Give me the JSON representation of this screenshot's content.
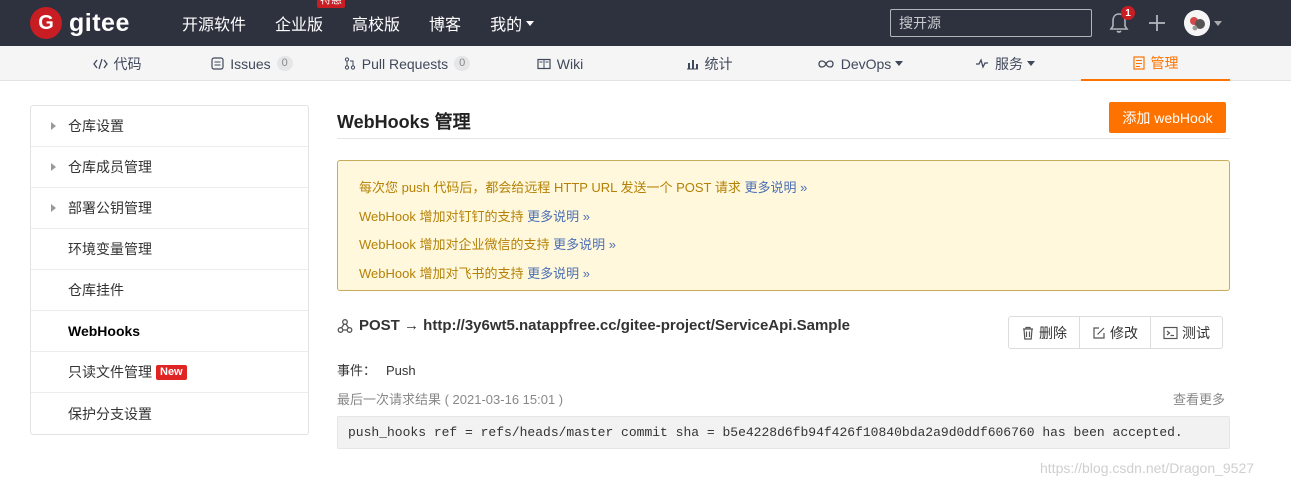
{
  "brand": {
    "badge": "G",
    "name": "gitee",
    "color": "#c71d23"
  },
  "topnav": {
    "links": [
      "开源软件",
      "企业版",
      "高校版",
      "博客",
      "我的"
    ],
    "hot_badge": "特惠",
    "search_placeholder": "搜开源",
    "notification_count": "1"
  },
  "repo_tabs": [
    {
      "label": "代码",
      "icon": "code-icon"
    },
    {
      "label": "Issues",
      "icon": "issues-icon",
      "count": "0"
    },
    {
      "label": "Pull Requests",
      "icon": "pull-request-icon",
      "count": "0"
    },
    {
      "label": "Wiki",
      "icon": "book-icon"
    },
    {
      "label": "统计",
      "icon": "bar-chart-icon"
    },
    {
      "label": "DevOps",
      "icon": "infinity-icon"
    },
    {
      "label": "服务",
      "icon": "pulse-icon"
    },
    {
      "label": "管理",
      "icon": "manage-icon",
      "active": true
    }
  ],
  "sidebar": {
    "items": [
      {
        "label": "仓库设置",
        "expandable": true
      },
      {
        "label": "仓库成员管理",
        "expandable": true
      },
      {
        "label": "部署公钥管理",
        "expandable": true
      },
      {
        "label": "环境变量管理"
      },
      {
        "label": "仓库挂件"
      },
      {
        "label": "WebHooks",
        "active": true
      },
      {
        "label": "只读文件管理",
        "badge": "New"
      },
      {
        "label": "保护分支设置"
      }
    ]
  },
  "main": {
    "title": "WebHooks 管理",
    "add_button": "添加 webHook",
    "notices": [
      {
        "text": "每次您 push 代码后，都会给远程 HTTP URL 发送一个 POST 请求 ",
        "link": "更多说明 »"
      },
      {
        "text": "WebHook 增加对钉钉的支持 ",
        "link": "更多说明 »"
      },
      {
        "text": "WebHook 增加对企业微信的支持 ",
        "link": "更多说明 »"
      },
      {
        "text": "WebHook 增加对飞书的支持 ",
        "link": "更多说明 »"
      }
    ],
    "hook": {
      "url": "POST → http://3y6wt5.natappfree.cc/gitee-project/ServiceApi.Sample",
      "actions": {
        "delete": "删除",
        "edit": "修改",
        "test": "测试"
      },
      "event_label": "事件：",
      "event_value": "Push",
      "last_request": "最后一次请求结果 ( 2021-03-16 15:01 )",
      "view_more": "查看更多",
      "response": "push_hooks ref = refs/heads/master commit sha = b5e4228d6fb94f426f10840bda2a9d0ddf606760 has been accepted."
    }
  },
  "watermark": "https://blog.csdn.net/Dragon_9527",
  "colors": {
    "accent": "#fe7300",
    "topbar": "#2e323e",
    "notice_text": "#b58105",
    "link": "#4b6fb5"
  }
}
